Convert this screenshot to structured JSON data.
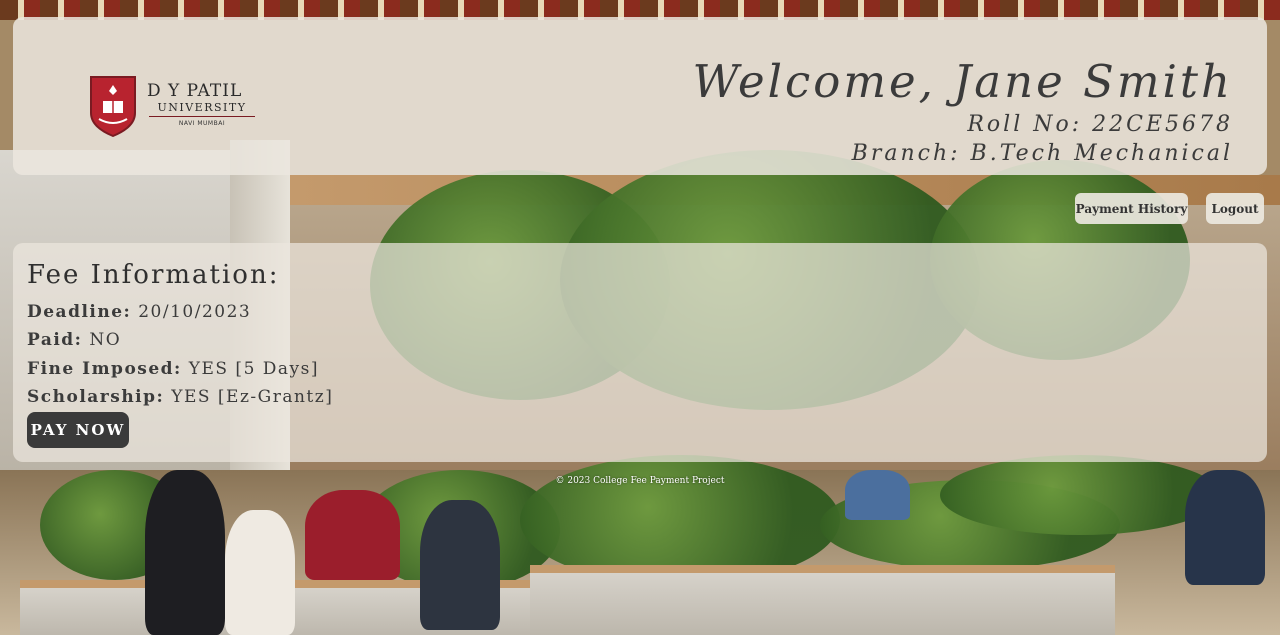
{
  "logo": {
    "name": "D Y PATIL",
    "subtitle": "UNIVERSITY",
    "location": "NAVI MUMBAI",
    "brand_color": "#b8232f"
  },
  "header": {
    "welcome": "Welcome, Jane Smith",
    "roll": "Roll No: 22CE5678",
    "branch": "Branch: B.Tech Mechanical"
  },
  "nav": {
    "payment_history": "Payment History",
    "logout": "Logout"
  },
  "fee": {
    "title": "Fee Information:",
    "deadline_label": "Deadline:",
    "deadline_value": "20/10/2023",
    "paid_label": "Paid:",
    "paid_value": "NO",
    "fine_label": "Fine Imposed:",
    "fine_value": "YES [5 Days]",
    "scholarship_label": "Scholarship:",
    "scholarship_value": "YES [Ez-Grantz]",
    "pay_button": "PAY NOW"
  },
  "footer": {
    "text": "© 2023 College Fee Payment Project"
  }
}
